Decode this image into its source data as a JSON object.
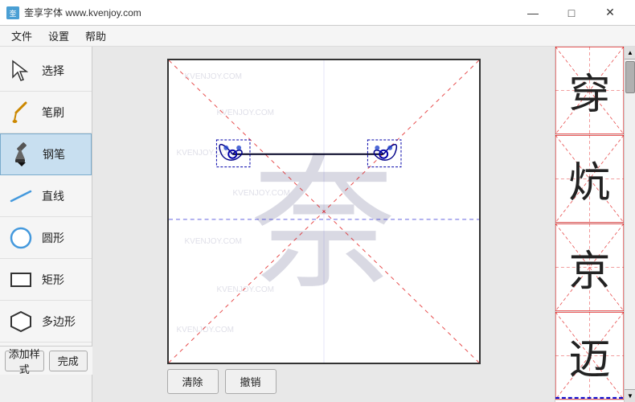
{
  "titleBar": {
    "title": "奎享字体 www.kvenjoy.com",
    "iconText": "奎"
  },
  "windowControls": {
    "minimize": "—",
    "maximize": "□",
    "close": "✕"
  },
  "menuBar": {
    "items": [
      "文件",
      "设置",
      "帮助"
    ]
  },
  "toolbar": {
    "tools": [
      {
        "id": "select",
        "label": "选择",
        "icon": "select"
      },
      {
        "id": "brush",
        "label": "笔刷",
        "icon": "brush"
      },
      {
        "id": "pen",
        "label": "钢笔",
        "icon": "pen"
      },
      {
        "id": "line",
        "label": "直线",
        "icon": "line"
      },
      {
        "id": "circle",
        "label": "圆形",
        "icon": "circle"
      },
      {
        "id": "rect",
        "label": "矩形",
        "icon": "rect"
      },
      {
        "id": "polygon",
        "label": "多边形",
        "icon": "polygon"
      }
    ],
    "addStyle": "添加样式",
    "complete": "完成"
  },
  "canvas": {
    "character": "奈",
    "watermarkText": "KVENJOY.COM"
  },
  "bottomButtons": {
    "clear": "清除",
    "undo": "撤销"
  },
  "rightPanel": {
    "characters": [
      "穿",
      "炕",
      "京",
      "迈"
    ]
  },
  "colors": {
    "accent": "#2060a0",
    "toolbarBg": "#f5f5f5",
    "canvasBorder": "#333",
    "redDash": "#e00",
    "blueDash": "#00c",
    "strokeBlue": "#00a"
  }
}
